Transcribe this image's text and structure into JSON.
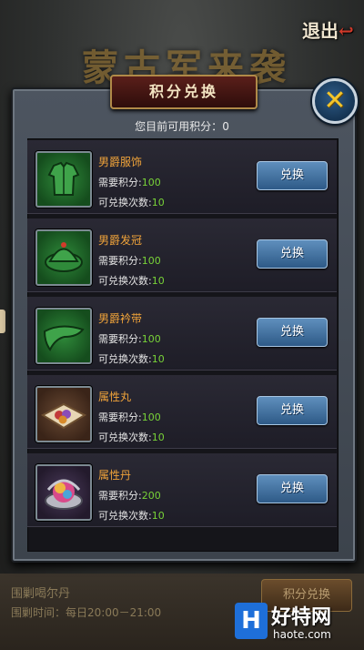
{
  "background": {
    "banner_text": "蒙古军来袭",
    "exit_label": "退出"
  },
  "panel": {
    "title": "积分兑换",
    "points_label": "您目前可用积分：",
    "points_value": "0"
  },
  "items": [
    {
      "name": "男爵服饰",
      "cost_label": "需要积分:",
      "cost": "100",
      "times_label": "可兑换次数:",
      "times": "10",
      "button": "兑换",
      "icon": "robe-icon"
    },
    {
      "name": "男爵发冠",
      "cost_label": "需要积分:",
      "cost": "100",
      "times_label": "可兑换次数:",
      "times": "10",
      "button": "兑换",
      "icon": "hat-icon"
    },
    {
      "name": "男爵衿带",
      "cost_label": "需要积分:",
      "cost": "100",
      "times_label": "可兑换次数:",
      "times": "10",
      "button": "兑换",
      "icon": "sash-icon"
    },
    {
      "name": "属性丸",
      "cost_label": "需要积分:",
      "cost": "100",
      "times_label": "可兑换次数:",
      "times": "10",
      "button": "兑换",
      "icon": "pill-tray-icon"
    },
    {
      "name": "属性丹",
      "cost_label": "需要积分:",
      "cost": "200",
      "times_label": "可兑换次数:",
      "times": "10",
      "button": "兑换",
      "icon": "elixir-orb-icon"
    }
  ],
  "bottom": {
    "event_title": "围剿喝尔丹",
    "event_time": "围剿时间：每日20:00－21:00",
    "exchange_button": "积分兑换"
  },
  "watermark": {
    "logo_letter": "H",
    "name": "好特网",
    "url": "haote.com"
  },
  "colors": {
    "item_name": "#f0a33a",
    "value_green": "#78d238",
    "button_blue": "#2e5a87",
    "close_x": "#f4c52a"
  }
}
